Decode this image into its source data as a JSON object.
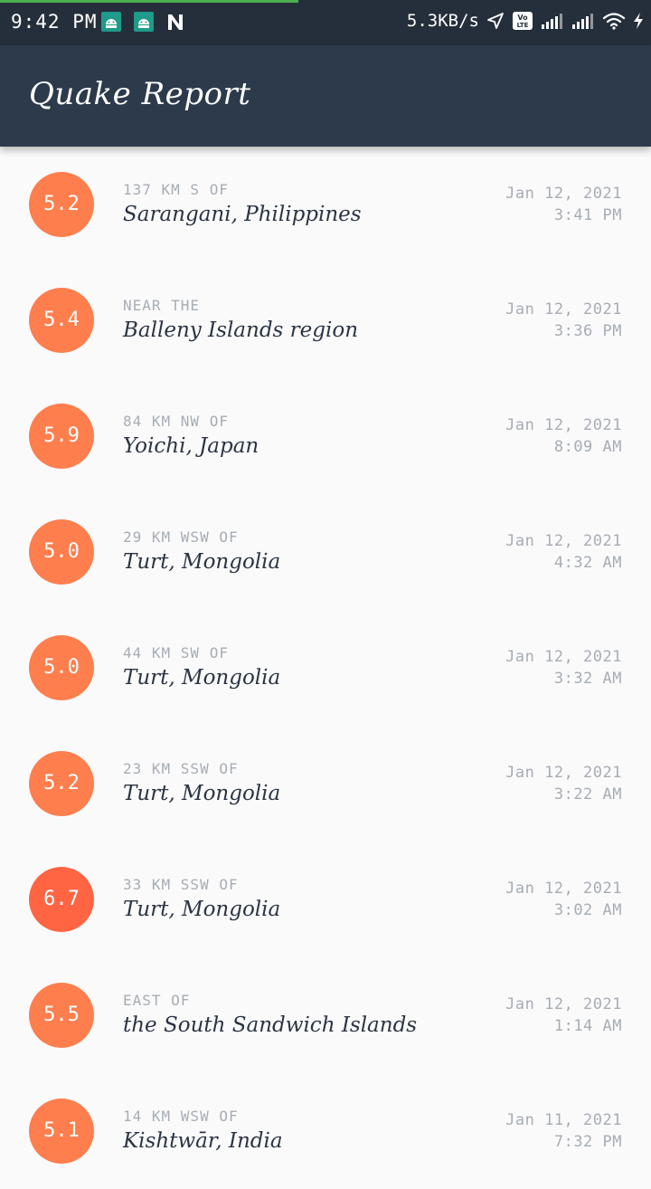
{
  "status_bar": {
    "time": "9:42 PM",
    "net_speed": "5.3KB/s",
    "volte": "Vo LTE",
    "progress_color": "#4caf50",
    "notification_icons": [
      "android-icon",
      "android-icon",
      "n-icon"
    ]
  },
  "app_bar": {
    "title": "Quake Report",
    "background": "#2c3a4b"
  },
  "earthquakes": [
    {
      "mag": "5.2",
      "offset": "137 KM S OF",
      "place": "Sarangani, Philippines",
      "date": "Jan 12, 2021",
      "time": "3:41 PM",
      "color": "#ff7e4d"
    },
    {
      "mag": "5.4",
      "offset": "NEAR THE",
      "place": "Balleny Islands region",
      "date": "Jan 12, 2021",
      "time": "3:36 PM",
      "color": "#ff7e4d"
    },
    {
      "mag": "5.9",
      "offset": "84 KM NW OF",
      "place": "Yoichi, Japan",
      "date": "Jan 12, 2021",
      "time": "8:09 AM",
      "color": "#ff7e4d"
    },
    {
      "mag": "5.0",
      "offset": "29 KM WSW OF",
      "place": "Turt, Mongolia",
      "date": "Jan 12, 2021",
      "time": "4:32 AM",
      "color": "#ff7e4d"
    },
    {
      "mag": "5.0",
      "offset": "44 KM SW OF",
      "place": "Turt, Mongolia",
      "date": "Jan 12, 2021",
      "time": "3:32 AM",
      "color": "#ff7e4d"
    },
    {
      "mag": "5.2",
      "offset": "23 KM SSW OF",
      "place": "Turt, Mongolia",
      "date": "Jan 12, 2021",
      "time": "3:22 AM",
      "color": "#ff7e4d"
    },
    {
      "mag": "6.7",
      "offset": "33 KM SSW OF",
      "place": "Turt, Mongolia",
      "date": "Jan 12, 2021",
      "time": "3:02 AM",
      "color": "#ff6543"
    },
    {
      "mag": "5.5",
      "offset": "EAST OF",
      "place": "the South Sandwich Islands",
      "date": "Jan 12, 2021",
      "time": "1:14 AM",
      "color": "#ff7e4d"
    },
    {
      "mag": "5.1",
      "offset": "14 KM WSW OF",
      "place": "Kishtwār, India",
      "date": "Jan 11, 2021",
      "time": "7:32 PM",
      "color": "#ff7e4d"
    }
  ]
}
